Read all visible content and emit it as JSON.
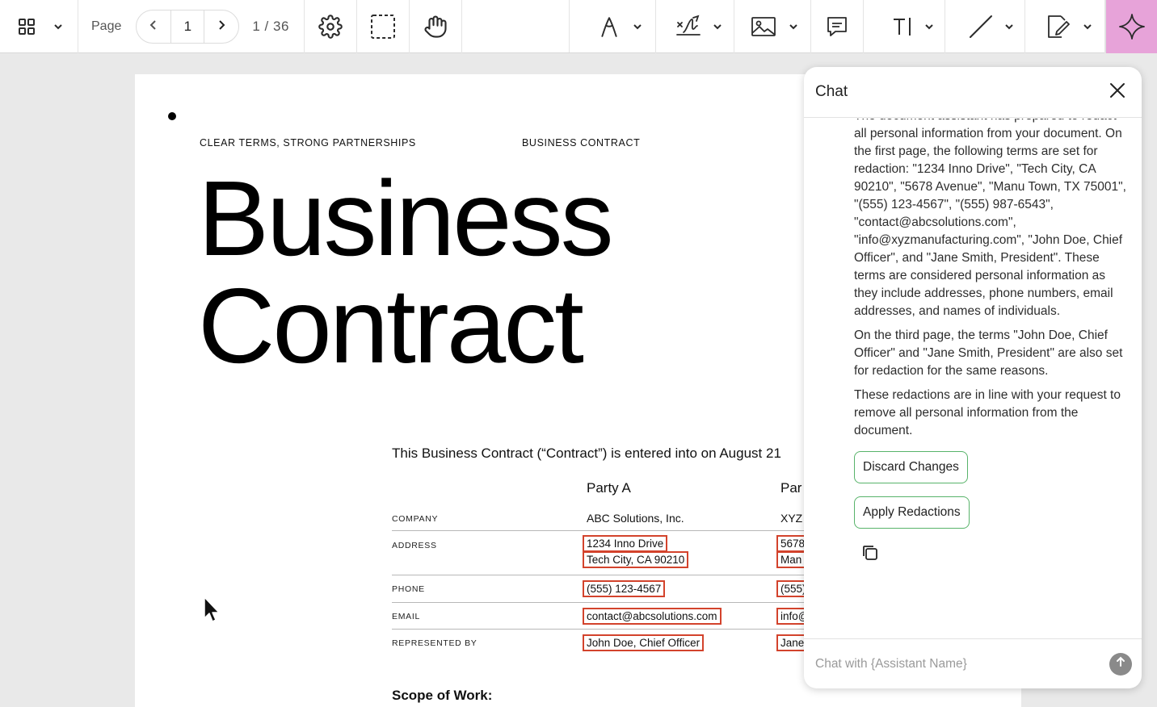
{
  "toolbar": {
    "page_label": "Page",
    "page_current": "1",
    "page_total": "1 / 36",
    "accent_color": "#e7a3d9"
  },
  "document": {
    "left_header": "CLEAR TERMS, STRONG PARTNERSHIPS",
    "right_header": "BUSINESS CONTRACT",
    "title_line1": "Business",
    "title_line2": "Contract",
    "intro": "This Business Contract (“Contract”) is entered into on August 21",
    "party_a_heading": "Party A",
    "party_b_heading": "Par",
    "rows": {
      "company": {
        "label": "COMPANY",
        "a": "ABC Solutions, Inc.",
        "b": "XYZ"
      },
      "address": {
        "label": "ADDRESS",
        "a1": "1234 Inno Drive",
        "a2": "Tech City, CA 90210",
        "b1": "5678",
        "b2": "Man"
      },
      "phone": {
        "label": "PHONE",
        "a": "(555) 123-4567",
        "b": "(555)"
      },
      "email": {
        "label": "EMAIL",
        "a": "contact@abcsolutions.com",
        "b": "info@"
      },
      "represented": {
        "label": "REPRESENTED BY",
        "a": "John Doe, Chief Officer",
        "b": "Jane"
      }
    },
    "scope_heading": "Scope of Work:",
    "redaction_color": "#d3432c"
  },
  "chat": {
    "title": "Chat",
    "messages": [
      "The document assistant has prepared to redact all personal information from your document. On the first page, the following terms are set for redaction: \"1234 Inno Drive\", \"Tech City, CA 90210\", \"5678 Avenue\", \"Manu Town, TX 75001\", \"(555) 123-4567\", \"(555) 987-6543\", \"contact@abcsolutions.com\", \"info@xyzmanufacturing.com\", \"John Doe, Chief Officer\", and \"Jane Smith, President\". These terms are considered personal information as they include addresses, phone numbers, email addresses, and names of individuals.",
      "On the third page, the terms \"John Doe, Chief Officer\" and \"Jane Smith, President\" are also set for redaction for the same reasons.",
      "These redactions are in line with your request to remove all personal information from the document."
    ],
    "discard_label": "Discard Changes",
    "apply_label": "Apply Redactions",
    "input_placeholder": "Chat with {Assistant Name}",
    "button_border_color": "#58b36a"
  }
}
